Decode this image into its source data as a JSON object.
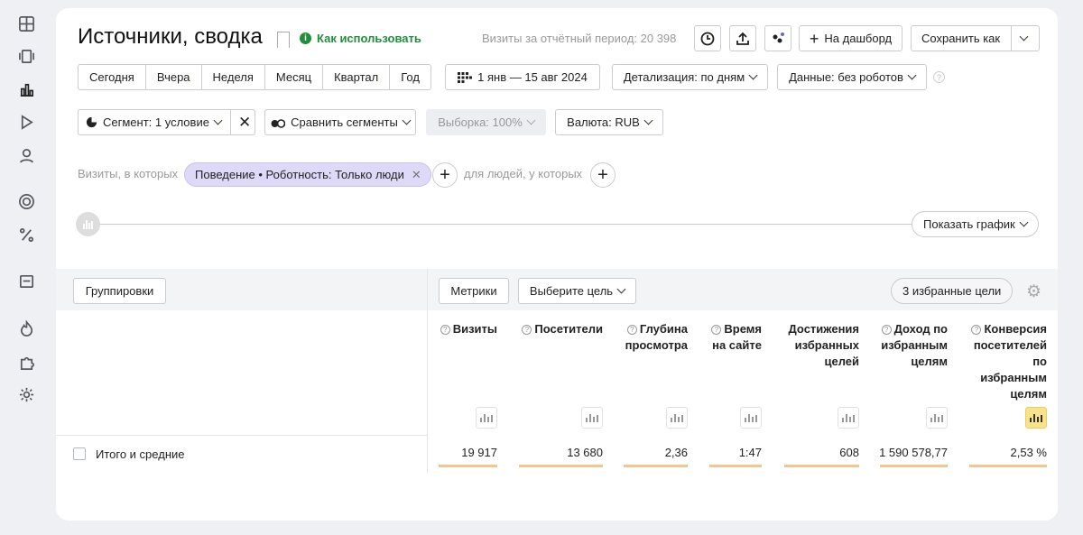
{
  "sidebar": {
    "icons": [
      "dashboard-icon",
      "widgets-icon",
      "reports-icon",
      "play-icon",
      "user-icon",
      "target-icon",
      "percent-icon",
      "calendar-icon",
      "fire-icon",
      "puzzle-icon",
      "gear-icon"
    ]
  },
  "header": {
    "title": "Источники, сводка",
    "howto": "Как использовать",
    "howto_mark": "i",
    "visits_period": "Визиты за отчётный период: 20 398",
    "to_dashboard": "На дашборд",
    "save_as": "Сохранить как"
  },
  "period": {
    "options": [
      "Сегодня",
      "Вчера",
      "Неделя",
      "Месяц",
      "Квартал",
      "Год"
    ],
    "date_range": "1 янв — 15 авг 2024",
    "detail": "Детализация: по дням",
    "data": "Данные: без роботов"
  },
  "segment": {
    "label": "Сегмент: 1 условие",
    "compare": "Сравнить сегменты",
    "sample": "Выборка: 100%",
    "currency": "Валюта: RUB"
  },
  "filters": {
    "prefix": "Визиты, в которых",
    "chip": "Поведение • Роботность: Только люди",
    "middle": "для людей, у которых"
  },
  "timeline": {
    "show_graph": "Показать график"
  },
  "table": {
    "groupings": "Группировки",
    "metrics": "Метрики",
    "select_goal": "Выберите цель",
    "favorite_goals": "3 избранные цели",
    "columns": [
      {
        "label": "Визиты",
        "value": "19 917"
      },
      {
        "label": "Посетители",
        "value": "13 680"
      },
      {
        "label": "Глубина просмотра",
        "value": "2,36"
      },
      {
        "label": "Время на сайте",
        "value": "1:47"
      },
      {
        "label": "Достижения избранных целей",
        "value": "608"
      },
      {
        "label": "Доход по избранным целям",
        "value": "1 590 578,77"
      },
      {
        "label": "Конверсия посетителей по избранным целям",
        "value": "2,53 %"
      }
    ],
    "totals_label": "Итого и средние"
  },
  "colors": {
    "accent_green": "#1f8f3a",
    "chip": "#ddd9f7",
    "bar": "#f6c48f",
    "active_chart": "#f9e38a"
  }
}
